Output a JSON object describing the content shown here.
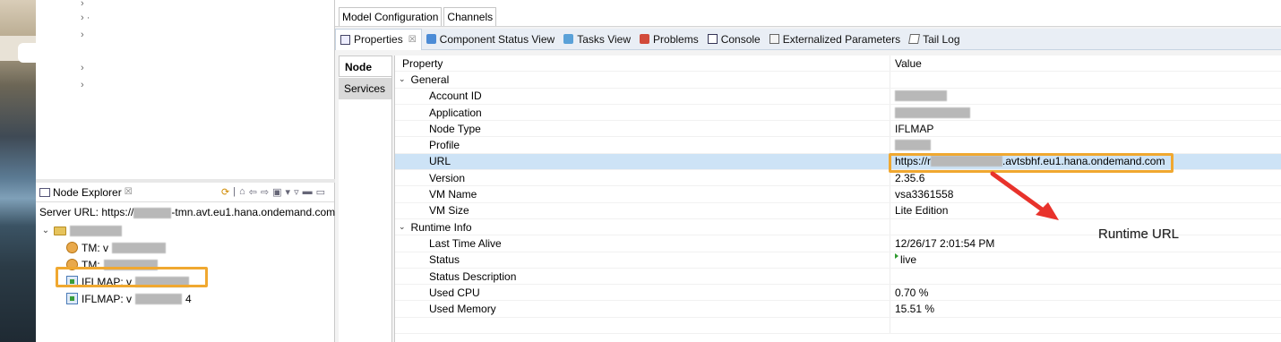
{
  "editor_tabs": [
    "Model Configuration",
    "Channels"
  ],
  "view_tabs": [
    {
      "label": "Properties",
      "icon": "properties-icon",
      "active": true,
      "closable": true
    },
    {
      "label": "Component Status View",
      "icon": "component-status-icon"
    },
    {
      "label": "Tasks View",
      "icon": "tasks-icon"
    },
    {
      "label": "Problems",
      "icon": "problems-icon"
    },
    {
      "label": "Console",
      "icon": "console-icon"
    },
    {
      "label": "Externalized Parameters",
      "icon": "parameters-icon"
    },
    {
      "label": "Tail Log",
      "icon": "tail-log-icon"
    }
  ],
  "side_tabs": [
    "Node",
    "Services"
  ],
  "table": {
    "col_property": "Property",
    "col_value": "Value",
    "general_label": "General",
    "runtime_label": "Runtime Info",
    "general": [
      {
        "name": "Account ID",
        "value": ""
      },
      {
        "name": "Application",
        "value": ""
      },
      {
        "name": "Node Type",
        "value": "IFLMAP"
      },
      {
        "name": "Profile",
        "value": ""
      },
      {
        "name": "URL",
        "value_prefix": "https://r",
        "value_suffix": ".avtsbhf.eu1.hana.ondemand.com"
      },
      {
        "name": "Version",
        "value": "2.35.6"
      },
      {
        "name": "VM Name",
        "value": "vsa3361558"
      },
      {
        "name": "VM Size",
        "value": "Lite Edition"
      }
    ],
    "runtime": [
      {
        "name": "Last Time Alive",
        "value": "12/26/17 2:01:54 PM"
      },
      {
        "name": "Status",
        "value": "live"
      },
      {
        "name": "Status Description",
        "value": ""
      },
      {
        "name": "Used CPU",
        "value": "0.70 %"
      },
      {
        "name": "Used Memory",
        "value": "15.51 %"
      }
    ]
  },
  "callout": "Runtime URL",
  "node_explorer": {
    "title": "Node Explorer",
    "server_url_prefix": "Server URL: https://",
    "server_url_suffix": "-tmn.avt.eu1.hana.ondemand.com",
    "nodes": [
      {
        "label": "TM: v",
        "icon": "tm-node-icon"
      },
      {
        "label": "TM: ",
        "icon": "tm-node-icon"
      },
      {
        "label": "IFLMAP: v",
        "icon": "iflmap-node-icon"
      },
      {
        "label": "IFLMAP: v",
        "suffix": "4",
        "icon": "iflmap-node-icon"
      }
    ]
  },
  "colors": {
    "highlight": "#f0a830",
    "arrow": "#e8322b",
    "selected_row": "#cde3f6"
  }
}
